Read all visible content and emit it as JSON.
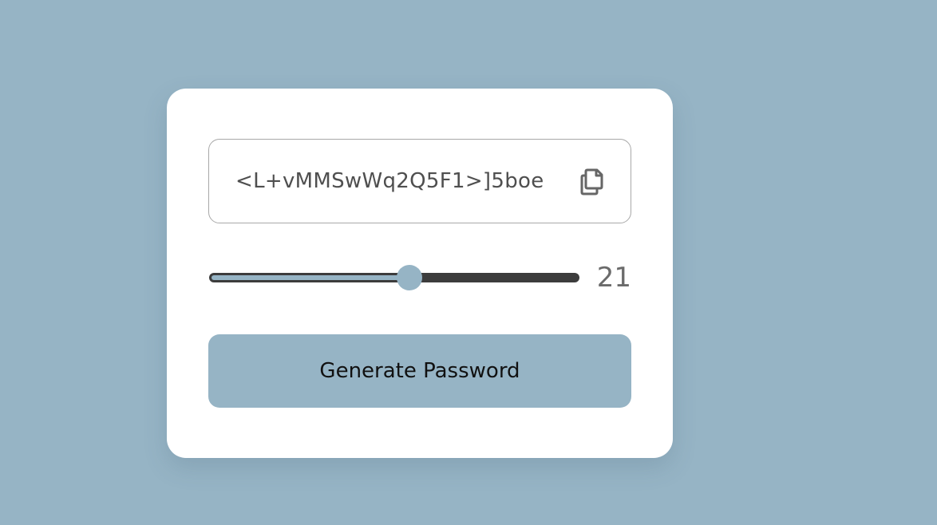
{
  "password": {
    "value": "<L+vMMSwWq2Q5F1>]5boe"
  },
  "copy_button": {
    "icon": "copy-icon"
  },
  "length_slider": {
    "value": 21,
    "min": 8,
    "max": 32,
    "display_value": "21"
  },
  "generate_button": {
    "label": "Generate Password"
  },
  "colors": {
    "background": "#96b4c5",
    "card": "#ffffff",
    "accent": "#96b4c5",
    "track": "#3c3c3c",
    "text": "#4f4f4f"
  }
}
